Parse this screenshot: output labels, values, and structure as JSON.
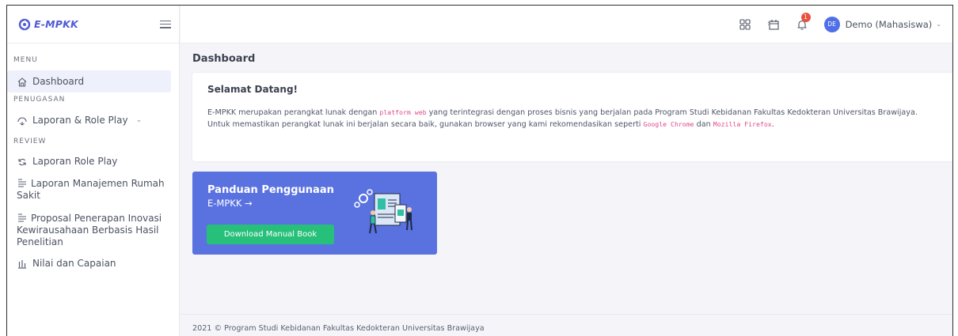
{
  "brand": {
    "name": "E-MPKK",
    "color": "#4f5bd5"
  },
  "sidebar": {
    "section_menu": "MENU",
    "section_penugasan": "PENUGASAN",
    "section_review": "REVIEW",
    "items": [
      {
        "label": "Dashboard",
        "icon": "home-icon",
        "active": true
      },
      {
        "label": "Laporan & Role Play",
        "icon": "laporan-icon"
      },
      {
        "label": "Laporan Role Play",
        "icon": "refresh-icon"
      },
      {
        "label": "Laporan Manajemen Rumah Sakit",
        "icon": "document-icon"
      },
      {
        "label": "Proposal Penerapan Inovasi Kewirausahaan Berbasis Hasil Penelitian",
        "icon": "document-icon"
      },
      {
        "label": "Nilai dan Capaian",
        "icon": "chart-icon"
      }
    ]
  },
  "topbar": {
    "notification_count": "1",
    "avatar_initials": "DE",
    "user_name": "Demo (Mahasiswa)",
    "icons": [
      "grid-icon",
      "calendar-icon",
      "bell-icon"
    ]
  },
  "main": {
    "page_title": "Dashboard",
    "welcome": {
      "title": "Selamat Datang!",
      "text_1": "E-MPKK merupakan perangkat lunak dengan ",
      "code_1": "platform web",
      "text_2": " yang terintegrasi dengan proses bisnis yang berjalan pada Program Studi Kebidanan Fakultas Kedokteran Universitas Brawijaya. Untuk memastikan perangkat lunak ini berjalan secara baik, gunakan browser yang kami rekomendasikan seperti ",
      "code_2": "Google Chrome",
      "text_3": " dan ",
      "code_3": "Mozilla Firefox",
      "text_4": "."
    },
    "guide": {
      "title": "Panduan Penggunaan",
      "subtitle": "E-MPKK →",
      "button_label": "Download Manual Book",
      "bg_color": "#5a72e0",
      "button_color": "#27c07a"
    }
  },
  "footer": {
    "text": "2021 © Program Studi Kebidanan Fakultas Kedokteran Universitas Brawijaya"
  }
}
